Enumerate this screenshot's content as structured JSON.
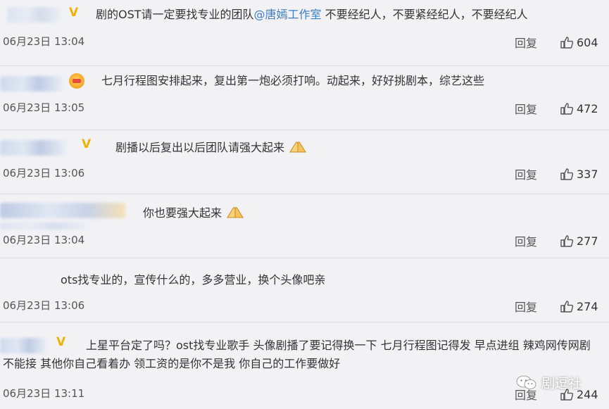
{
  "comments": [
    {
      "text_before": "剧的OST请一定要找专业的团队",
      "mention": "@唐嫣工作室",
      "text_after": " 不要经纪人，不要紧经纪人，不要经纪人",
      "time": "06月23日 13:04",
      "reply_label": "回复",
      "likes": "604",
      "badge": "V"
    },
    {
      "text": "七月行程图安排起来，复出第一炮必须打响。动起来，好好挑剧本，综艺这些",
      "time": "06月23日 13:05",
      "reply_label": "回复",
      "likes": "472"
    },
    {
      "text": "剧播以后复出以后团队请强大起来",
      "time": "06月23日 13:06",
      "reply_label": "回复",
      "likes": "337",
      "badge": "V"
    },
    {
      "text": "你也要强大起来",
      "time": "06月23日 13:04",
      "reply_label": "回复",
      "likes": "277"
    },
    {
      "text": "ots找专业的，宣传什么的，多多营业，换个头像吧亲",
      "time": "06月23日 13:06",
      "reply_label": "回复",
      "likes": "274"
    },
    {
      "text": "上星平台定了吗？ost找专业歌手 头像剧播了要记得换一下 七月行程图记得发 早点进组 辣鸡网传网剧不能接 其他你自己看着办 领工资的是你不是我 你自己的工作要做好",
      "time": "06月23日 13:11",
      "reply_label": "回复",
      "likes": "244",
      "badge": "V"
    }
  ],
  "watermark": "剧逗社",
  "colors": {
    "mention": "#3b7ec7",
    "badge": "#f0b100",
    "background": "#f2f2f5"
  }
}
